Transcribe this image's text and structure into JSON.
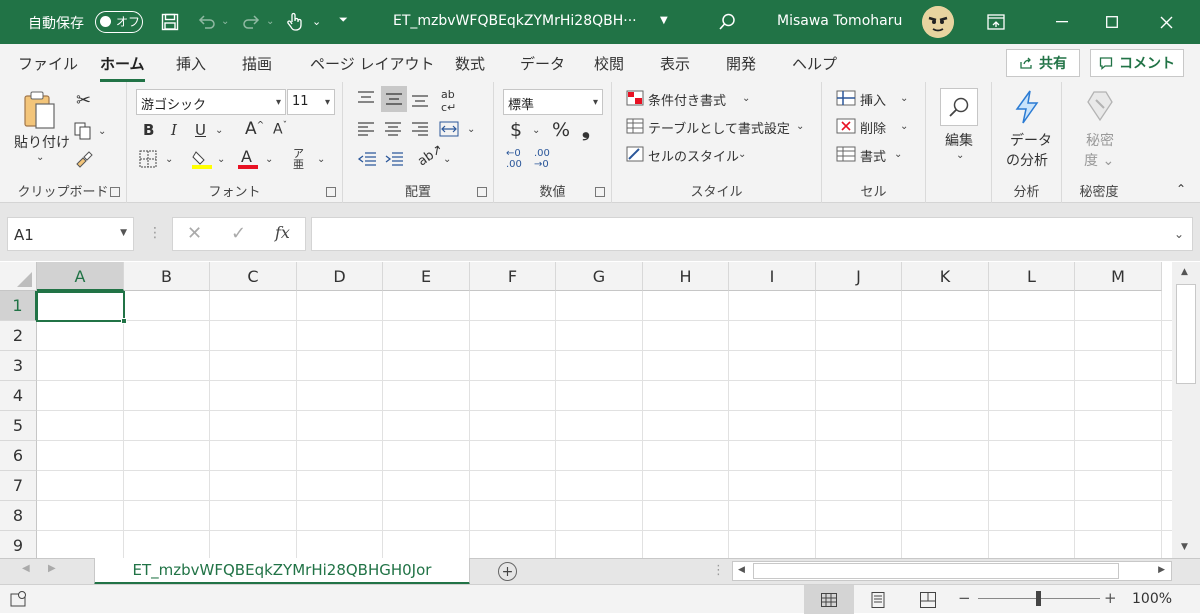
{
  "titlebar": {
    "autosave_label": "自動保存",
    "autosave_state": "オフ",
    "filename": "ET_mzbvWFQBEqkZYMrHi28QBH···",
    "user": "Misawa Tomoharu"
  },
  "tabs": [
    "ファイル",
    "ホーム",
    "挿入",
    "描画",
    "ページ レイアウト",
    "数式",
    "データ",
    "校閲",
    "表示",
    "開発",
    "ヘルプ"
  ],
  "share_label": "共有",
  "comment_label": "コメント",
  "ribbon": {
    "clipboard": {
      "paste": "貼り付け",
      "label": "クリップボード"
    },
    "font": {
      "name": "游ゴシック",
      "size": "11",
      "bold": "B",
      "italic": "I",
      "underline": "U",
      "label": "フォント"
    },
    "align": {
      "label": "配置"
    },
    "number": {
      "format": "標準",
      "label": "数値"
    },
    "styles": {
      "conditional": "条件付き書式",
      "table": "テーブルとして書式設定",
      "cell": "セルのスタイル",
      "label": "スタイル"
    },
    "cells": {
      "insert": "挿入",
      "delete": "削除",
      "format": "書式",
      "label": "セル"
    },
    "edit": {
      "label": "編集"
    },
    "analysis": {
      "line1": "データ",
      "line2": "の分析",
      "label": "分析"
    },
    "sensitivity": {
      "line1": "秘密",
      "line2": "度",
      "label": "秘密度"
    }
  },
  "namebox": "A1",
  "columns": [
    "A",
    "B",
    "C",
    "D",
    "E",
    "F",
    "G",
    "H",
    "I",
    "J",
    "K",
    "L",
    "M"
  ],
  "rows": [
    "1",
    "2",
    "3",
    "4",
    "5",
    "6",
    "7",
    "8",
    "9"
  ],
  "sheet_tab": "ET_mzbvWFQBEqkZYMrHi28QBHGH0Jor",
  "zoom": "100%",
  "accent_color": "#217346"
}
